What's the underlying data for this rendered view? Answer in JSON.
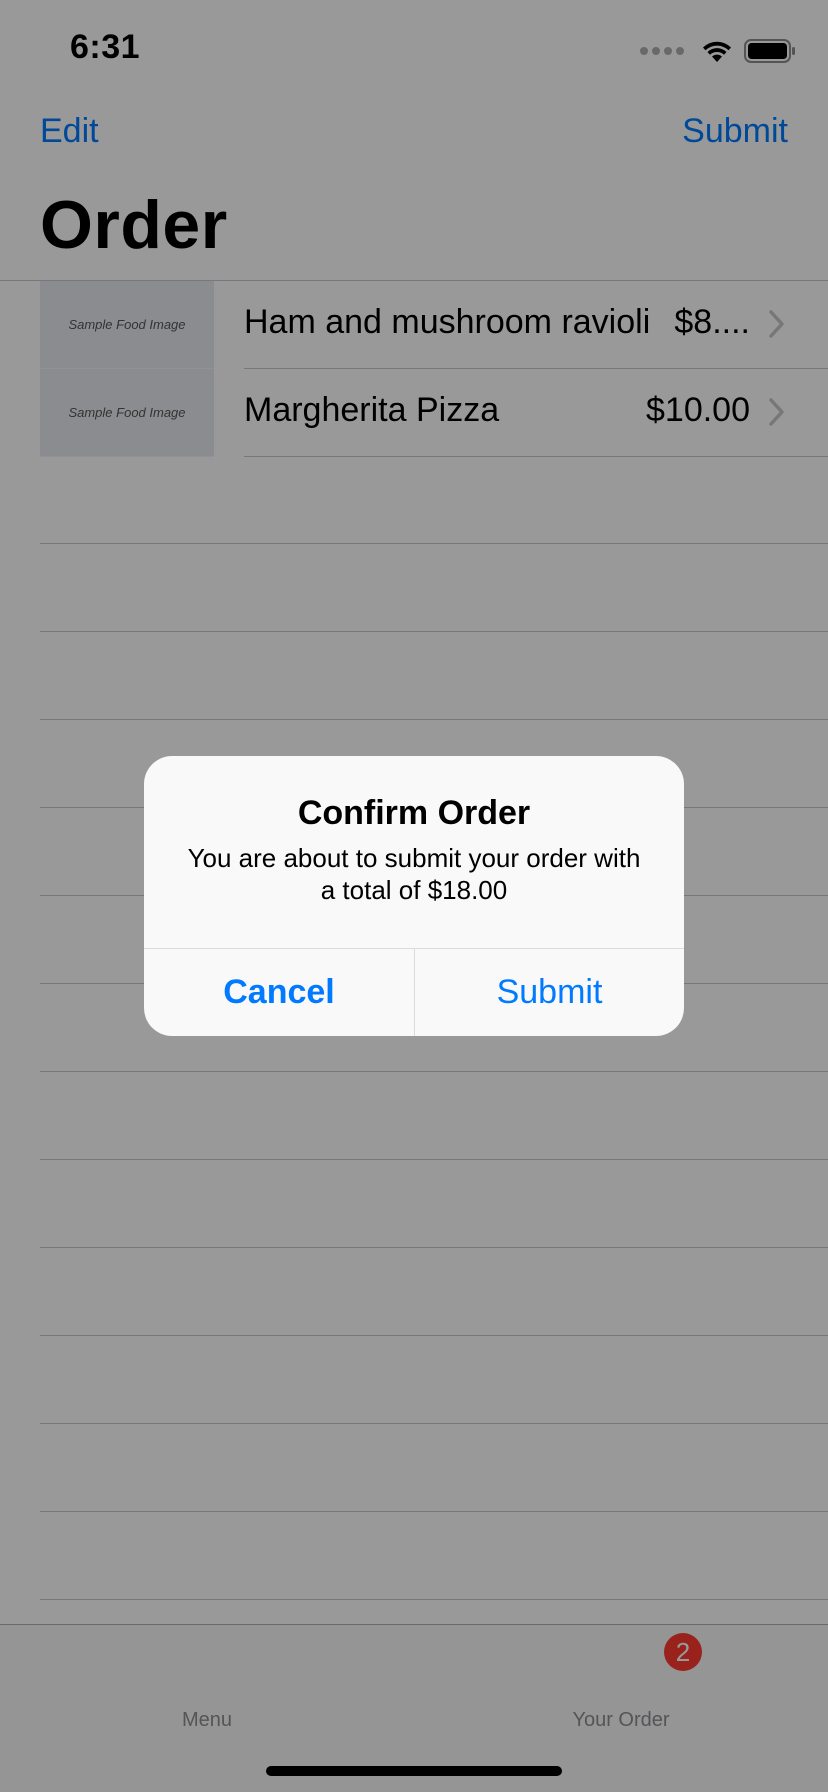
{
  "status_bar": {
    "time": "6:31"
  },
  "nav": {
    "edit_label": "Edit",
    "submit_label": "Submit",
    "title": "Order"
  },
  "order_items": [
    {
      "image_caption": "Sample Food Image",
      "name": "Ham and mushroom ravioli",
      "price": "$8...."
    },
    {
      "image_caption": "Sample Food Image",
      "name": "Margherita Pizza",
      "price": "$10.00"
    }
  ],
  "tab_bar": {
    "tabs": [
      {
        "label": "Menu"
      },
      {
        "label": "Your Order",
        "badge": "2"
      }
    ]
  },
  "alert": {
    "title": "Confirm Order",
    "message": "You are about to submit your order with a total of $18.00",
    "cancel_label": "Cancel",
    "submit_label": "Submit"
  },
  "colors": {
    "tint": "#007aff",
    "badge": "#ff3b30",
    "overlay": "rgba(0,0,0,0.4)"
  },
  "icons": {
    "wifi": "wifi-icon",
    "battery": "battery-icon",
    "signal": "cellular-signal-icon",
    "chevron": "chevron-right-icon"
  }
}
